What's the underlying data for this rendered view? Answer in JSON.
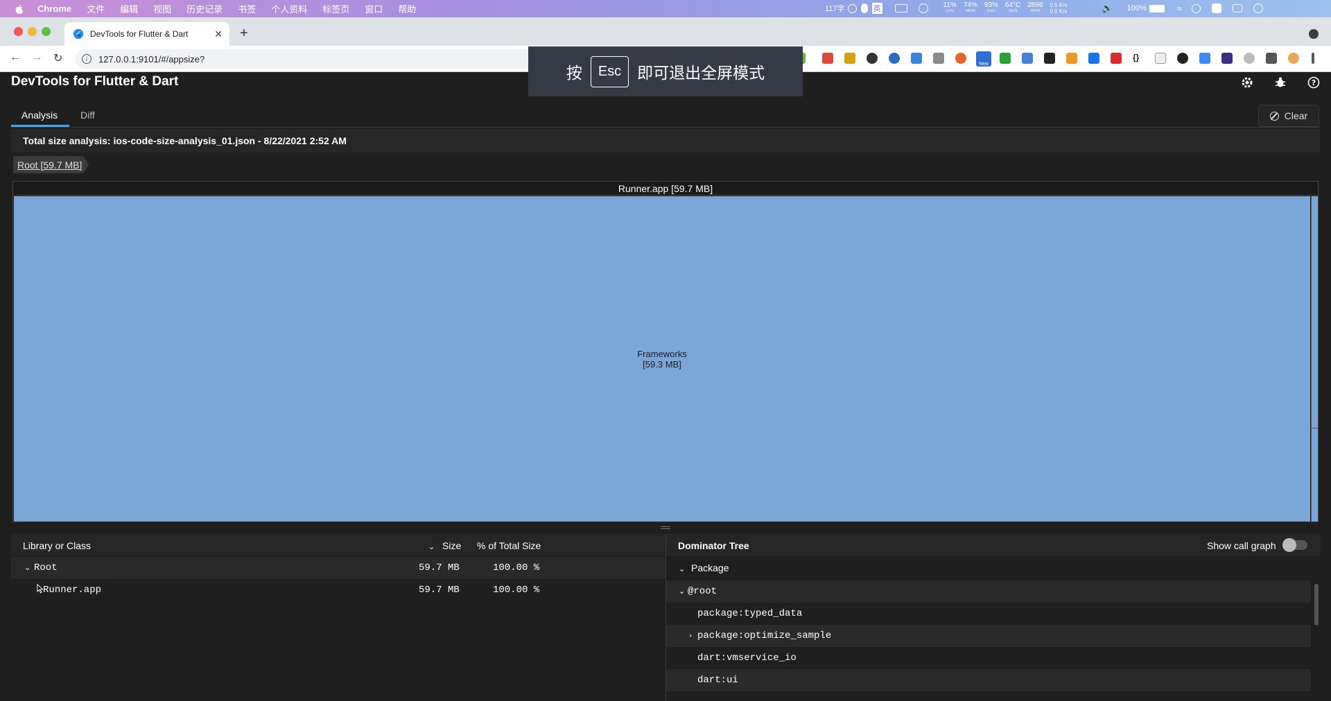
{
  "menubar": {
    "app": "Chrome",
    "items": [
      "文件",
      "编辑",
      "视图",
      "历史记录",
      "书签",
      "个人资料",
      "标签页",
      "窗口",
      "帮助"
    ],
    "status": {
      "word_count": "117字",
      "input_lang": "英",
      "cpu": {
        "value": "11%",
        "label": "CPU"
      },
      "mem": {
        "value": "74%",
        "label": "MEM"
      },
      "ssd": {
        "value": "93%",
        "label": "SSD"
      },
      "sen": {
        "value": "64°C",
        "label": "SEN"
      },
      "rpm": {
        "value": "2896",
        "label": "RPM"
      },
      "net_up": "0.5 K/s",
      "net_down": "0.0 K/s",
      "battery": "100%"
    }
  },
  "browser": {
    "tab_title": "DevTools for Flutter & Dart",
    "close_glyph": "✕",
    "new_tab_glyph": "+",
    "url": "127.0.0.1:9101/#/appsize?",
    "fullscreen_toast": {
      "prefix": "按",
      "key": "Esc",
      "suffix": "即可退出全屏模式"
    },
    "new_badge": "New"
  },
  "app": {
    "title": "DevTools for Flutter & Dart",
    "tabs": [
      "Analysis",
      "Diff"
    ],
    "active_tab": "Analysis",
    "clear_label": "Clear",
    "analysis_info": "Total size analysis: ios-code-size-analysis_01.json - 8/22/2021 2:52 AM",
    "breadcrumb": "Root [59.7 MB]",
    "treemap": {
      "header": "Runner.app [59.7 MB]",
      "main_block_name": "Frameworks",
      "main_block_size": "[59.3 MB]"
    },
    "table": {
      "columns": {
        "name": "Library or Class",
        "size": "Size",
        "percent": "% of Total Size"
      },
      "rows": [
        {
          "name": "Root",
          "size": "59.7 MB",
          "percent": "100.00 %",
          "expanded": true
        },
        {
          "name": "Runner.app",
          "size": "59.7 MB",
          "percent": "100.00 %",
          "expanded": false
        }
      ]
    },
    "dominator": {
      "title": "Dominator Tree",
      "show_call_graph_label": "Show call graph",
      "show_call_graph": false,
      "group_label": "Package",
      "root": "@root",
      "items": [
        "package:typed_data",
        "package:optimize_sample",
        "dart:vmservice_io",
        "dart:ui"
      ]
    }
  },
  "colors": {
    "treemap_block": "#7ba6d8",
    "accent": "#4aa6f5",
    "background": "#1f1f1f"
  }
}
